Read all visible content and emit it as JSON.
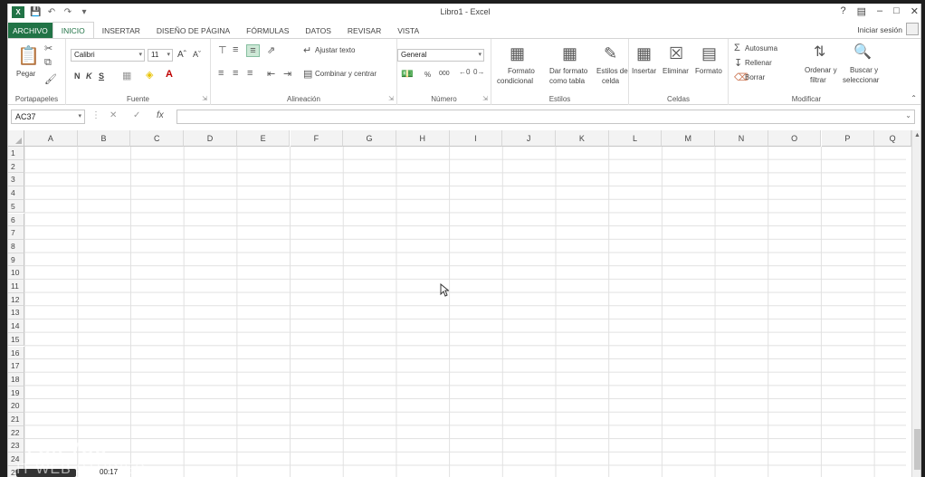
{
  "window": {
    "title": "Libro1 - Excel",
    "logo": "X",
    "controls": [
      "?",
      "▤",
      "–",
      "□",
      "✕"
    ]
  },
  "tabs": {
    "file": "ARCHIVO",
    "items": [
      "INICIO",
      "INSERTAR",
      "DISEÑO DE PÁGINA",
      "FÓRMULAS",
      "DATOS",
      "REVISAR",
      "VISTA"
    ],
    "active": "INICIO",
    "signin": "Iniciar sesión"
  },
  "ribbon": {
    "clipboard": {
      "label": "Portapapeles",
      "paste": "Pegar"
    },
    "font": {
      "label": "Fuente",
      "name": "Calibri",
      "size": "11",
      "bold": "N",
      "italic": "K",
      "underline": "S"
    },
    "alignment": {
      "label": "Alineación",
      "wrap": "Ajustar texto",
      "merge": "Combinar y centrar"
    },
    "number": {
      "label": "Número",
      "format": "General",
      "percent": "%",
      "thousands": "000"
    },
    "styles": {
      "label": "Estilos",
      "conditional": [
        "Formato",
        "condicional"
      ],
      "as_table": [
        "Dar formato",
        "como tabla"
      ],
      "cell_styles": [
        "Estilos de",
        "celda"
      ]
    },
    "cells": {
      "label": "Celdas",
      "insert": "Insertar",
      "delete": "Eliminar",
      "format": "Formato"
    },
    "editing": {
      "label": "Modificar",
      "autosum": "Autosuma",
      "fill": "Rellenar",
      "clear": "Borrar",
      "sort": [
        "Ordenar y",
        "filtrar"
      ],
      "find": [
        "Buscar y",
        "seleccionar"
      ]
    }
  },
  "formula_bar": {
    "name_box": "AC37",
    "cancel": "✕",
    "enter": "✓",
    "fx": "fx",
    "value": ""
  },
  "grid": {
    "columns": [
      "A",
      "B",
      "C",
      "D",
      "E",
      "F",
      "G",
      "H",
      "I",
      "J",
      "K",
      "L",
      "M",
      "N",
      "O",
      "P",
      "Q"
    ],
    "rows": [
      "1",
      "2",
      "3",
      "4",
      "5",
      "6",
      "7",
      "8",
      "9",
      "10",
      "11",
      "12",
      "13",
      "14",
      "15",
      "16",
      "17",
      "18",
      "19",
      "20",
      "21",
      "22",
      "23",
      "24",
      "25"
    ]
  },
  "overlay": {
    "line1": "FOR YOU",
    "line2": "IT WEB STUDIES",
    "time": "00:17"
  },
  "colors": {
    "brand": "#217346",
    "highlight": "#cde8d6"
  }
}
